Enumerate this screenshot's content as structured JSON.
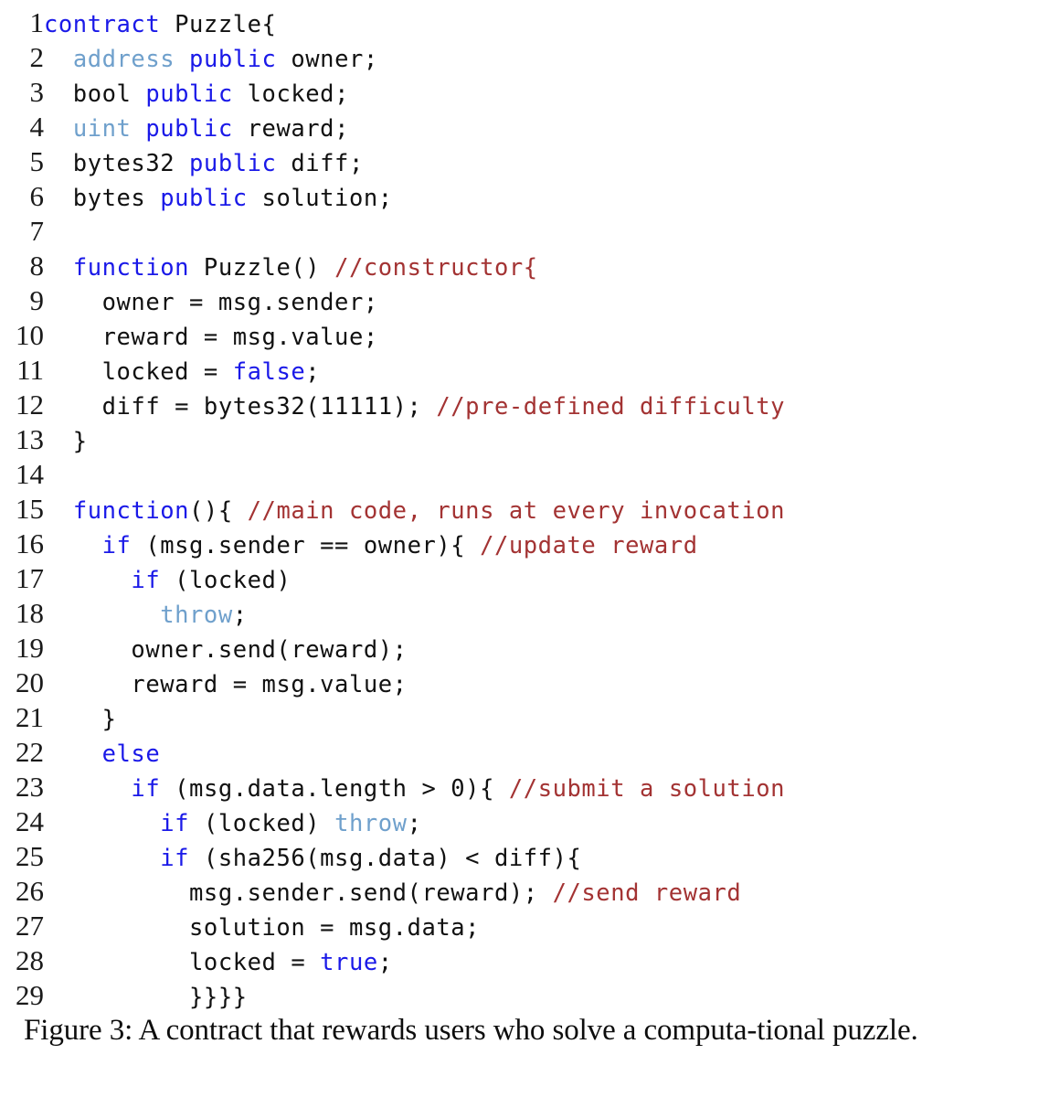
{
  "figure": {
    "caption": "Figure 3: A contract that rewards users who solve a computa-tional puzzle.",
    "caption_line1": "Figure 3: A contract that rewards users who solve a computa-",
    "caption_line2": "tional puzzle."
  },
  "colors": {
    "background": "#ffffff",
    "keyword_blue": "#1a19e8",
    "type_blue": "#6fa0cc",
    "comment_red": "#a33333",
    "code_black": "#111111",
    "line_number": "#1a1a1a"
  },
  "listing": {
    "language": "Solidity",
    "first_line_number": 1,
    "last_line_number": 29,
    "lines": [
      {
        "num": "1",
        "text": "contract Puzzle{",
        "tokens": [
          {
            "t": "contract",
            "c": "kw"
          },
          {
            "t": " Puzzle{",
            "c": "plain"
          }
        ]
      },
      {
        "num": "2",
        "text": "  address public owner;",
        "tokens": [
          {
            "t": "  ",
            "c": "plain"
          },
          {
            "t": "address",
            "c": "type"
          },
          {
            "t": " ",
            "c": "plain"
          },
          {
            "t": "public",
            "c": "kw"
          },
          {
            "t": " owner;",
            "c": "plain"
          }
        ]
      },
      {
        "num": "3",
        "text": "  bool public locked;",
        "tokens": [
          {
            "t": "  bool ",
            "c": "plain"
          },
          {
            "t": "public",
            "c": "kw"
          },
          {
            "t": " locked;",
            "c": "plain"
          }
        ]
      },
      {
        "num": "4",
        "text": "  uint public reward;",
        "tokens": [
          {
            "t": "  ",
            "c": "plain"
          },
          {
            "t": "uint",
            "c": "type"
          },
          {
            "t": " ",
            "c": "plain"
          },
          {
            "t": "public",
            "c": "kw"
          },
          {
            "t": " reward;",
            "c": "plain"
          }
        ]
      },
      {
        "num": "5",
        "text": "  bytes32 public diff;",
        "tokens": [
          {
            "t": "  bytes32 ",
            "c": "plain"
          },
          {
            "t": "public",
            "c": "kw"
          },
          {
            "t": " diff;",
            "c": "plain"
          }
        ]
      },
      {
        "num": "6",
        "text": "  bytes public solution;",
        "tokens": [
          {
            "t": "  bytes ",
            "c": "plain"
          },
          {
            "t": "public",
            "c": "kw"
          },
          {
            "t": " solution;",
            "c": "plain"
          }
        ]
      },
      {
        "num": "7",
        "text": "",
        "tokens": []
      },
      {
        "num": "8",
        "text": "  function Puzzle() //constructor{",
        "tokens": [
          {
            "t": "  ",
            "c": "plain"
          },
          {
            "t": "function",
            "c": "kw"
          },
          {
            "t": " Puzzle() ",
            "c": "plain"
          },
          {
            "t": "//constructor{",
            "c": "comment"
          }
        ]
      },
      {
        "num": "9",
        "text": "    owner = msg.sender;",
        "tokens": [
          {
            "t": "    owner = msg.sender;",
            "c": "plain"
          }
        ]
      },
      {
        "num": "10",
        "text": "    reward = msg.value;",
        "tokens": [
          {
            "t": "    reward = msg.value;",
            "c": "plain"
          }
        ]
      },
      {
        "num": "11",
        "text": "    locked = false;",
        "tokens": [
          {
            "t": "    locked = ",
            "c": "plain"
          },
          {
            "t": "false",
            "c": "kw"
          },
          {
            "t": ";",
            "c": "plain"
          }
        ]
      },
      {
        "num": "12",
        "text": "    diff = bytes32(11111); //pre-defined difficulty",
        "tokens": [
          {
            "t": "    diff = bytes32(11111); ",
            "c": "plain"
          },
          {
            "t": "//pre-defined difficulty",
            "c": "comment"
          }
        ]
      },
      {
        "num": "13",
        "text": "  }",
        "tokens": [
          {
            "t": "  }",
            "c": "plain"
          }
        ]
      },
      {
        "num": "14",
        "text": "",
        "tokens": []
      },
      {
        "num": "15",
        "text": "  function(){ //main code, runs at every invocation",
        "tokens": [
          {
            "t": "  ",
            "c": "plain"
          },
          {
            "t": "function",
            "c": "kw"
          },
          {
            "t": "(){ ",
            "c": "plain"
          },
          {
            "t": "//main code, runs at every invocation",
            "c": "comment"
          }
        ]
      },
      {
        "num": "16",
        "text": "    if (msg.sender == owner){ //update reward",
        "tokens": [
          {
            "t": "    ",
            "c": "plain"
          },
          {
            "t": "if",
            "c": "kw"
          },
          {
            "t": " (msg.sender == owner){ ",
            "c": "plain"
          },
          {
            "t": "//update reward",
            "c": "comment"
          }
        ]
      },
      {
        "num": "17",
        "text": "      if (locked)",
        "tokens": [
          {
            "t": "      ",
            "c": "plain"
          },
          {
            "t": "if",
            "c": "kw"
          },
          {
            "t": " (locked)",
            "c": "plain"
          }
        ]
      },
      {
        "num": "18",
        "text": "        throw;",
        "tokens": [
          {
            "t": "        ",
            "c": "plain"
          },
          {
            "t": "throw",
            "c": "type"
          },
          {
            "t": ";",
            "c": "plain"
          }
        ]
      },
      {
        "num": "19",
        "text": "      owner.send(reward);",
        "tokens": [
          {
            "t": "      owner.send(reward);",
            "c": "plain"
          }
        ]
      },
      {
        "num": "20",
        "text": "      reward = msg.value;",
        "tokens": [
          {
            "t": "      reward = msg.value;",
            "c": "plain"
          }
        ]
      },
      {
        "num": "21",
        "text": "    }",
        "tokens": [
          {
            "t": "    }",
            "c": "plain"
          }
        ]
      },
      {
        "num": "22",
        "text": "    else",
        "tokens": [
          {
            "t": "    ",
            "c": "plain"
          },
          {
            "t": "else",
            "c": "kw"
          }
        ]
      },
      {
        "num": "23",
        "text": "      if (msg.data.length > 0){ //submit a solution",
        "tokens": [
          {
            "t": "      ",
            "c": "plain"
          },
          {
            "t": "if",
            "c": "kw"
          },
          {
            "t": " (msg.data.length > 0){ ",
            "c": "plain"
          },
          {
            "t": "//submit a solution",
            "c": "comment"
          }
        ]
      },
      {
        "num": "24",
        "text": "        if (locked) throw;",
        "tokens": [
          {
            "t": "        ",
            "c": "plain"
          },
          {
            "t": "if",
            "c": "kw"
          },
          {
            "t": " (locked) ",
            "c": "plain"
          },
          {
            "t": "throw",
            "c": "type"
          },
          {
            "t": ";",
            "c": "plain"
          }
        ]
      },
      {
        "num": "25",
        "text": "        if (sha256(msg.data) < diff){",
        "tokens": [
          {
            "t": "        ",
            "c": "plain"
          },
          {
            "t": "if",
            "c": "kw"
          },
          {
            "t": " (sha256(msg.data) < diff){",
            "c": "plain"
          }
        ]
      },
      {
        "num": "26",
        "text": "          msg.sender.send(reward); //send reward",
        "tokens": [
          {
            "t": "          msg.sender.send(reward); ",
            "c": "plain"
          },
          {
            "t": "//send reward",
            "c": "comment"
          }
        ]
      },
      {
        "num": "27",
        "text": "          solution = msg.data;",
        "tokens": [
          {
            "t": "          solution = msg.data;",
            "c": "plain"
          }
        ]
      },
      {
        "num": "28",
        "text": "          locked = true;",
        "tokens": [
          {
            "t": "          locked = ",
            "c": "plain"
          },
          {
            "t": "true",
            "c": "kw"
          },
          {
            "t": ";",
            "c": "plain"
          }
        ]
      },
      {
        "num": "29",
        "text": "          }}}}",
        "tokens": [
          {
            "t": "          }}}}",
            "c": "plain"
          }
        ]
      }
    ]
  }
}
